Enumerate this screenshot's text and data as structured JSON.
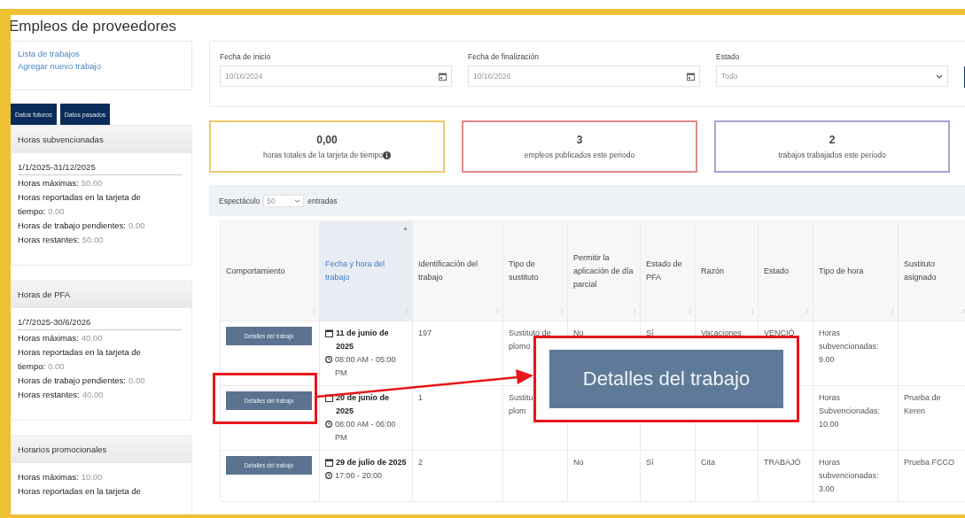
{
  "page_title": "Empleos de proveedores",
  "sidebar": {
    "links": [
      "Lista de trabajos",
      "Agregar nuevo trabajo"
    ],
    "buttons": [
      "Datos futuros",
      "Datos pasados"
    ],
    "cards": [
      {
        "title": "Horas subvencionadas",
        "period": "1/1/2025-31/12/2025",
        "lines": [
          {
            "label": "Horas máximas:",
            "value": "50.00"
          },
          {
            "label": "Horas reportadas en la tarjeta de tiempo:",
            "value": "0.00"
          },
          {
            "label": "Horas de trabajo pendientes:",
            "value": "0.00"
          },
          {
            "label": "Horas restantes:",
            "value": "50.00"
          }
        ]
      },
      {
        "title": "Horas de PFA",
        "period": "1/7/2025-30/6/2026",
        "lines": [
          {
            "label": "Horas máximas:",
            "value": "40.00"
          },
          {
            "label": "Horas reportadas en la tarjeta de tiempo:",
            "value": "0.00"
          },
          {
            "label": "Horas de trabajo pendientes:",
            "value": "0.00"
          },
          {
            "label": "Horas restantes:",
            "value": "40.00"
          }
        ]
      },
      {
        "title": "Horarios promocionales",
        "lines": [
          {
            "label": "Horas máximas:",
            "value": "10.00"
          },
          {
            "label": "Horas reportadas en la tarjeta de"
          }
        ]
      }
    ]
  },
  "filters": [
    {
      "kind": "date",
      "label": "Fecha de inicio",
      "value": "10/16/2024"
    },
    {
      "kind": "date",
      "label": "Fecha de finalización",
      "value": "10/16/2026"
    },
    {
      "kind": "select",
      "label": "Estado",
      "value": "Todo"
    }
  ],
  "stats": [
    {
      "value": "0,00",
      "label": "horas totales de la tarjeta de tiempo",
      "color": "#efcb6c",
      "info": true
    },
    {
      "value": "3",
      "label": "empleos publicados este periodo",
      "color": "#e08a8a",
      "info": false
    },
    {
      "value": "2",
      "label": "trabajos trabajados este periodo",
      "color": "#a9a3d6",
      "info": false
    }
  ],
  "page_length": {
    "before": "Espectáculo",
    "value": "50",
    "after": "entradas"
  },
  "table": {
    "columns": [
      {
        "label": "Comportamiento",
        "sorted": false
      },
      {
        "label": "Fecha y hora del trabajo",
        "sorted": true
      },
      {
        "label": "Identificación del trabajo",
        "sorted": false
      },
      {
        "label": "Tipo de sustituto",
        "sorted": false
      },
      {
        "label": "Permitir la aplicación de día parcial",
        "sorted": false
      },
      {
        "label": "Estado de PFA",
        "sorted": false
      },
      {
        "label": "Razón",
        "sorted": false
      },
      {
        "label": "Estado",
        "sorted": false
      },
      {
        "label": "Tipo de hora",
        "sorted": false
      },
      {
        "label": "Sustituto asignado",
        "sorted": false
      }
    ],
    "rows": [
      {
        "cells": [
          {
            "kind": "button",
            "label": "Detalles del trabajo"
          },
          {
            "kind": "datetime",
            "date": "11 de junio de 2025",
            "time": "08:00 AM - 05:00 PM"
          },
          "197",
          "Sustituto de plomo",
          "No",
          "Sí",
          "Vacaciones",
          "VENCIÓ",
          "Horas subvencionadas: 9.00",
          ""
        ]
      },
      {
        "cells": [
          {
            "kind": "button",
            "label": "Detalles del trabajo"
          },
          {
            "kind": "datetime",
            "date": "20 de junio de 2025",
            "time": "08:00 AM - 06:00 PM"
          },
          "1",
          "Sustitu\nplom",
          "",
          "",
          "",
          "",
          "Horas Subvencionadas: 10.00",
          "Prueba de Keren"
        ]
      },
      {
        "cells": [
          {
            "kind": "button",
            "label": "Detalles del trabajo"
          },
          {
            "kind": "datetime",
            "date": "29 de julio de 2025",
            "time": "17:00 - 20:00"
          },
          "2",
          "",
          "No",
          "Sí",
          "Cita",
          "TRABAJÓ",
          "Horas subvencionadas: 3.00",
          "Prueba FCCO"
        ]
      }
    ]
  },
  "callout": {
    "label": "Detalles del trabajo"
  }
}
